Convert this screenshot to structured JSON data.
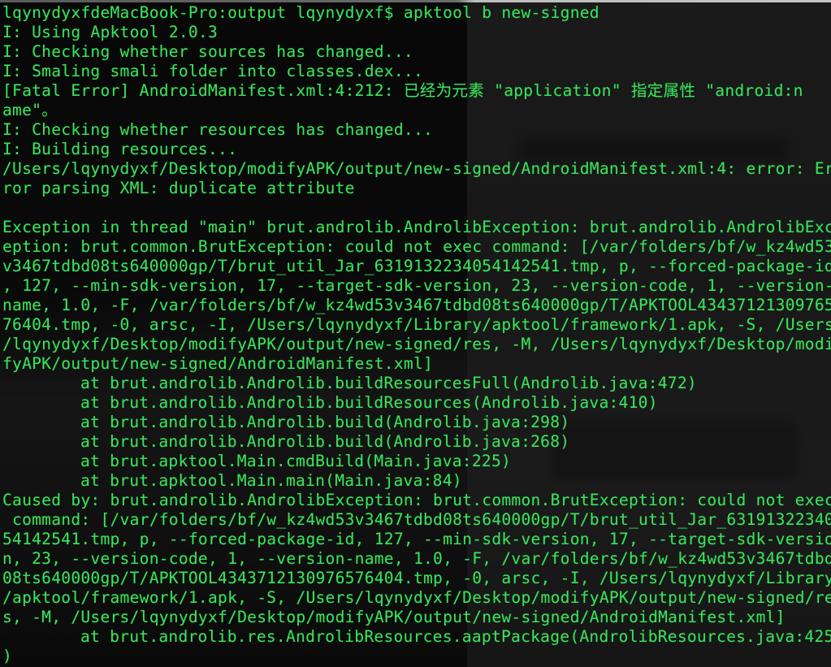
{
  "terminal": {
    "text_color": "#39e25a",
    "background_color": "#0b0b0b",
    "prompt": "lqynydyxfdeMacBook-Pro:output lqynydyxf$",
    "command": "apktool b new-signed",
    "lines": [
      {
        "kind": "command",
        "text": "lqynydyxfdeMacBook-Pro:output lqynydyxf$ apktool b new-signed"
      },
      {
        "kind": "info",
        "text": "I: Using Apktool 2.0.3"
      },
      {
        "kind": "info",
        "text": "I: Checking whether sources has changed..."
      },
      {
        "kind": "info",
        "text": "I: Smaling smali folder into classes.dex..."
      },
      {
        "kind": "error",
        "text": "[Fatal Error] AndroidManifest.xml:4:212: 已经为元素 \"application\" 指定属性 \"android:n"
      },
      {
        "kind": "error",
        "text": "ame\"。"
      },
      {
        "kind": "info",
        "text": "I: Checking whether resources has changed..."
      },
      {
        "kind": "info",
        "text": "I: Building resources..."
      },
      {
        "kind": "error",
        "text": "/Users/lqynydyxf/Desktop/modifyAPK/output/new-signed/AndroidManifest.xml:4: error: Er"
      },
      {
        "kind": "error",
        "text": "ror parsing XML: duplicate attribute"
      },
      {
        "kind": "blank",
        "text": ""
      },
      {
        "kind": "exception",
        "text": "Exception in thread \"main\" brut.androlib.AndrolibException: brut.androlib.AndrolibExc"
      },
      {
        "kind": "exception",
        "text": "eption: brut.common.BrutException: could not exec command: [/var/folders/bf/w_kz4wd53"
      },
      {
        "kind": "exception",
        "text": "v3467tdbd08ts640000gp/T/brut_util_Jar_6319132234054142541.tmp, p, --forced-package-id"
      },
      {
        "kind": "exception",
        "text": ", 127, --min-sdk-version, 17, --target-sdk-version, 23, --version-code, 1, --version-"
      },
      {
        "kind": "exception",
        "text": "name, 1.0, -F, /var/folders/bf/w_kz4wd53v3467tdbd08ts640000gp/T/APKTOOL43437121309765"
      },
      {
        "kind": "exception",
        "text": "76404.tmp, -0, arsc, -I, /Users/lqynydyxf/Library/apktool/framework/1.apk, -S, /Users"
      },
      {
        "kind": "exception",
        "text": "/lqynydyxf/Desktop/modifyAPK/output/new-signed/res, -M, /Users/lqynydyxf/Desktop/modi"
      },
      {
        "kind": "exception",
        "text": "fyAPK/output/new-signed/AndroidManifest.xml]"
      },
      {
        "kind": "stack",
        "text": "at brut.androlib.Androlib.buildResourcesFull(Androlib.java:472)"
      },
      {
        "kind": "stack",
        "text": "at brut.androlib.Androlib.buildResources(Androlib.java:410)"
      },
      {
        "kind": "stack",
        "text": "at brut.androlib.Androlib.build(Androlib.java:298)"
      },
      {
        "kind": "stack",
        "text": "at brut.androlib.Androlib.build(Androlib.java:268)"
      },
      {
        "kind": "stack",
        "text": "at brut.apktool.Main.cmdBuild(Main.java:225)"
      },
      {
        "kind": "stack",
        "text": "at brut.apktool.Main.main(Main.java:84)"
      },
      {
        "kind": "exception",
        "text": "Caused by: brut.androlib.AndrolibException: brut.common.BrutException: could not exec"
      },
      {
        "kind": "exception",
        "text": " command: [/var/folders/bf/w_kz4wd53v3467tdbd08ts640000gp/T/brut_util_Jar_63191322340"
      },
      {
        "kind": "exception",
        "text": "54142541.tmp, p, --forced-package-id, 127, --min-sdk-version, 17, --target-sdk-versio"
      },
      {
        "kind": "exception",
        "text": "n, 23, --version-code, 1, --version-name, 1.0, -F, /var/folders/bf/w_kz4wd53v3467tdbd"
      },
      {
        "kind": "exception",
        "text": "08ts640000gp/T/APKTOOL4343712130976576404.tmp, -0, arsc, -I, /Users/lqynydyxf/Library"
      },
      {
        "kind": "exception",
        "text": "/apktool/framework/1.apk, -S, /Users/lqynydyxf/Desktop/modifyAPK/output/new-signed/re"
      },
      {
        "kind": "exception",
        "text": "s, -M, /Users/lqynydyxf/Desktop/modifyAPK/output/new-signed/AndroidManifest.xml]"
      },
      {
        "kind": "stack",
        "text": "at brut.androlib.res.AndrolibResources.aaptPackage(AndrolibResources.java:425"
      },
      {
        "kind": "exception",
        "text": ")"
      }
    ]
  }
}
